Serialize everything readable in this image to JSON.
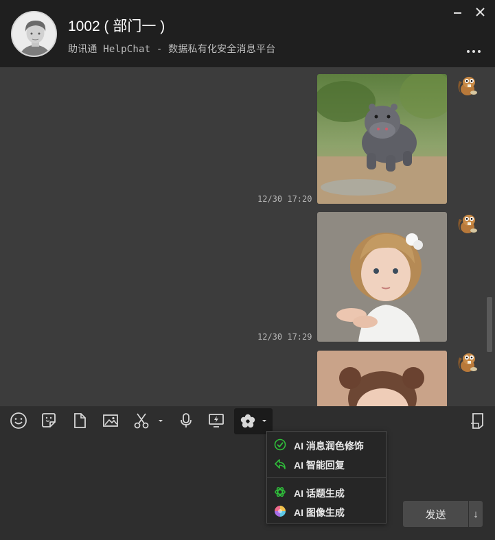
{
  "header": {
    "title": "1002 ( 部门一 )",
    "subtitle_prefix": "助讯通 HelpChat - ",
    "subtitle_suffix": "数据私有化安全消息平台",
    "minimize_icon": "minimize-icon",
    "close_icon": "close-icon",
    "more_icon": "more-icon"
  },
  "messages": [
    {
      "image": "baby-hippo-photo",
      "time": "12/30 17:20"
    },
    {
      "image": "toddler-girl-photo",
      "time": "12/30 17:29"
    },
    {
      "image": "toddler-pigtails-photo",
      "time": ""
    }
  ],
  "toolbar": {
    "icons": [
      "emoji-icon",
      "sticker-icon",
      "file-icon",
      "image-icon",
      "scissors-icon",
      "mic-icon",
      "screen-share-icon",
      "ai-flower-icon",
      "history-icon"
    ]
  },
  "ai_menu": {
    "items": [
      {
        "label": "AI 消息润色修饰",
        "icon": "check-circle-icon"
      },
      {
        "label": "AI 智能回复",
        "icon": "reply-icon"
      },
      {
        "label": "AI 话题生成",
        "icon": "openai-icon"
      },
      {
        "label": "AI 图像生成",
        "icon": "color-wheel-icon"
      }
    ]
  },
  "input": {
    "send_label": "发送",
    "send_arrow": "↓"
  },
  "colors": {
    "header_bg": "#1f1f1f",
    "chat_bg": "#3c3c3c",
    "toolbar_bg": "#2e2e2e",
    "ai_green": "#2fbf3a"
  }
}
